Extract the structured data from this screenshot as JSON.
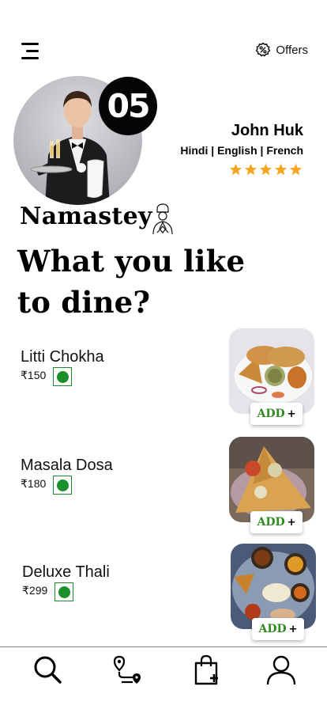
{
  "header": {
    "offers_label": "Offers",
    "menu_icon": "menu-icon",
    "offers_icon": "discount-badge-icon"
  },
  "waiter": {
    "table_number": "05",
    "name": "John Huk",
    "languages": "Hindi | English | French",
    "rating": 5,
    "star_color": "#f5a623"
  },
  "greeting": {
    "title": "Namastey",
    "icon": "namaste-chef-icon",
    "headline_line1": "What you like",
    "headline_line2": "to dine?"
  },
  "menu": {
    "add_label": "ADD",
    "add_icon": "plus",
    "veg_color": "#1a8f2a",
    "items": [
      {
        "name": "Litti Chokha",
        "price": "₹150",
        "veg": true
      },
      {
        "name": "Masala Dosa",
        "price": "₹180",
        "veg": true
      },
      {
        "name": "Deluxe Thali",
        "price": "₹299",
        "veg": true
      }
    ]
  },
  "bottom_nav": [
    {
      "icon": "search-icon"
    },
    {
      "icon": "route-icon"
    },
    {
      "icon": "shopping-bag-icon"
    },
    {
      "icon": "profile-icon"
    }
  ]
}
